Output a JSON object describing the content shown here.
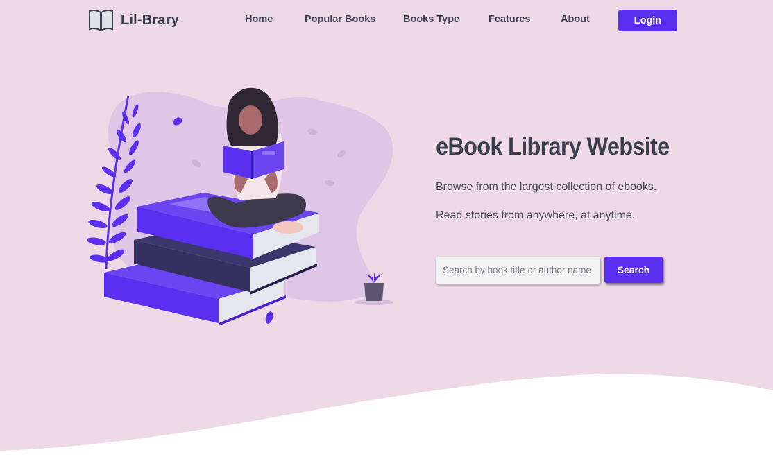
{
  "brand": {
    "name": "Lil-Brary",
    "icon": "open-book-icon"
  },
  "nav": {
    "items": [
      {
        "label": "Home"
      },
      {
        "label": "Popular Books"
      },
      {
        "label": "Books Type"
      },
      {
        "label": "Features"
      },
      {
        "label": "About"
      }
    ],
    "login_label": "Login"
  },
  "hero": {
    "title": "eBook Library Website",
    "line1": "Browse from the largest collection of ebooks.",
    "line2": "Read stories from anywhere, at anytime.",
    "search_placeholder": "Search by book title or author name",
    "search_label": "Search"
  },
  "colors": {
    "accent": "#5b2ff0",
    "hero_bg": "#eed9e6",
    "text_dark": "#3b3e4c"
  }
}
